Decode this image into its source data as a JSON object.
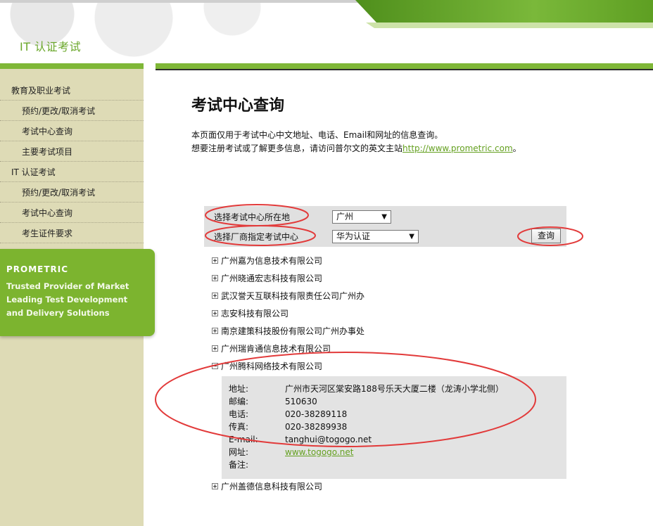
{
  "header": {
    "title": "IT 认证考试"
  },
  "sidebar": {
    "items": [
      {
        "label": "教育及职业考试",
        "level": 1
      },
      {
        "label": "预约/更改/取消考试",
        "level": 2
      },
      {
        "label": "考试中心查询",
        "level": 2
      },
      {
        "label": "主要考试项目",
        "level": 2
      },
      {
        "label": "IT 认证考试",
        "level": 1
      },
      {
        "label": "预约/更改/取消考试",
        "level": 2
      },
      {
        "label": "考试中心查询",
        "level": 2
      },
      {
        "label": "考生证件要求",
        "level": 2
      }
    ],
    "promo": {
      "brand": "PROMETRIC",
      "text": "Trusted Provider of Market Leading Test Development and Delivery Solutions"
    }
  },
  "main": {
    "title": "考试中心查询",
    "intro_line1": "本页面仅用于考试中心中文地址、电话、Email和网址的信息查询。",
    "intro_line2_prefix": "想要注册考试或了解更多信息，请访问普尔文的英文主站",
    "intro_link": "http://www.prometric.com",
    "intro_line2_suffix": "。"
  },
  "search": {
    "location_label": "选择考试中心所在地",
    "location_value": "广州",
    "vendor_label": "选择厂商指定考试中心",
    "vendor_value": "华为认证",
    "search_button": "查询"
  },
  "centers": [
    {
      "name": "广州嘉为信息技术有限公司",
      "expanded": false
    },
    {
      "name": "广州晓通宏志科技有限公司",
      "expanded": false
    },
    {
      "name": "武汉誉天互联科技有限责任公司广州办",
      "expanded": false
    },
    {
      "name": "志安科技有限公司",
      "expanded": false
    },
    {
      "name": "南京建策科技股份有限公司广州办事处",
      "expanded": false
    },
    {
      "name": "广州瑞肯通信息技术有限公司",
      "expanded": false
    },
    {
      "name": "广州腾科网络技术有限公司",
      "expanded": true
    },
    {
      "name": "广州盖德信息科技有限公司",
      "expanded": false
    }
  ],
  "detail": {
    "address_label": "地址:",
    "address": "广州市天河区棠安路188号乐天大厦二楼（龙涛小学北侧）",
    "postcode_label": "邮编:",
    "postcode": "510630",
    "phone_label": "电话:",
    "phone": "020-38289118",
    "fax_label": "传真:",
    "fax": "020-38289938",
    "email_label": "E-mail:",
    "email": "tanghui@togogo.net",
    "website_label": "网址:",
    "website": "www.togogo.net",
    "note_label": "备注:",
    "note": ""
  },
  "colors": {
    "brand_green": "#7fb737",
    "link_green": "#64a020",
    "sidebar_bg": "#dedbb6",
    "annotation_red": "#e23a3a"
  }
}
